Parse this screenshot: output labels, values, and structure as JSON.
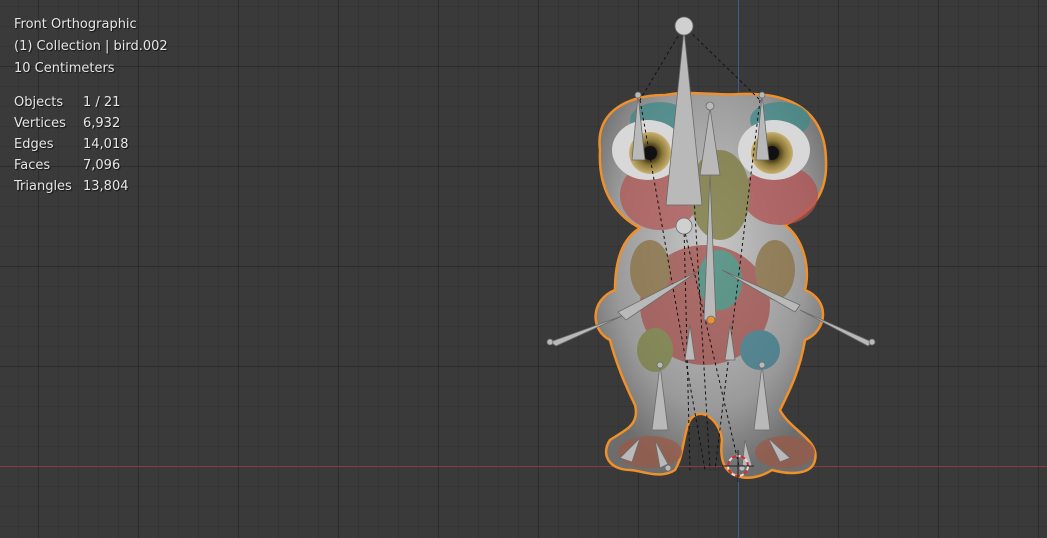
{
  "viewport": {
    "view_name": "Front Orthographic",
    "collection": "(1) Collection | bird.002",
    "scale": "10 Centimeters",
    "accent_selection": "#f0902a",
    "axis_x_color": "#8a3b44",
    "axis_z_color": "#3d5d8c"
  },
  "stats": [
    {
      "label": "Objects",
      "value": "1 / 21"
    },
    {
      "label": "Vertices",
      "value": "6,932"
    },
    {
      "label": "Edges",
      "value": "14,018"
    },
    {
      "label": "Faces",
      "value": "7,096"
    },
    {
      "label": "Triangles",
      "value": "13,804"
    }
  ]
}
